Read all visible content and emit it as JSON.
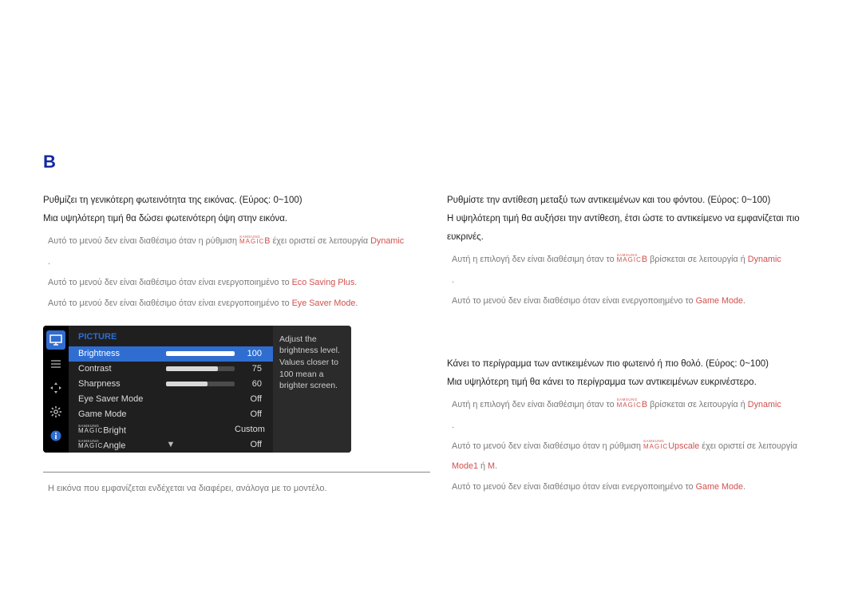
{
  "section_mark": "B",
  "left": {
    "p1": "Ρυθμίζει τη γενικότερη φωτεινότητα της εικόνας. (Εύρος: 0~100)",
    "p2": "Μια υψηλότερη τιμή θα δώσει φωτεινότερη όψη στην εικόνα.",
    "b1_pre": "Αυτό το μενού δεν είναι διαθέσιμο όταν η ρύθμιση ",
    "b1_mid": "B",
    "b1_after": " έχει οριστεί σε λειτουργία ",
    "b1_red": "Dynamic",
    "b1_end": ".",
    "b2_pre": "Αυτό το μενού δεν είναι διαθέσιμο όταν είναι ενεργοποιημένο το ",
    "b2_red": "Eco Saving Plus",
    "b2_end": ".",
    "b3_pre": "Αυτό το μενού δεν είναι διαθέσιμο όταν είναι ενεργοποιημένο το ",
    "b3_red": "Eye Saver Mode",
    "b3_end": ".",
    "footnote": "Η εικόνα που εμφανίζεται ενδέχεται να διαφέρει, ανάλογα με το μοντέλο.",
    "magic_top": "SAMSUNG",
    "magic_bot": "MAGIC"
  },
  "right1": {
    "p1": "Ρυθμίστε την αντίθεση μεταξύ των αντικειμένων και του φόντου. (Εύρος: 0~100)",
    "p2": "Η υψηλότερη τιμή θα αυξήσει την αντίθεση, έτσι ώστε το αντικείμενο να εμφανίζεται πιο ευκρινές.",
    "b1_pre": "Αυτή η επιλογή δεν είναι διαθέσιμη όταν το ",
    "b1_mid": "B",
    "b1_after": " βρίσκεται σε λειτουργία  ή ",
    "b1_red": "Dynamic",
    "b1_end": ".",
    "b2_pre": "Αυτό το μενού δεν είναι διαθέσιμο όταν είναι ενεργοποιημένο το ",
    "b2_red": "Game Mode",
    "b2_end": "."
  },
  "right2": {
    "p1": "Κάνει το περίγραμμα των αντικειμένων πιο φωτεινό ή πιο θολό. (Εύρος: 0~100)",
    "p2": "Μια υψηλότερη τιμή θα κάνει το περίγραμμα των αντικειμένων ευκρινέστερο.",
    "b1_pre": "Αυτή η επιλογή δεν είναι διαθέσιμη όταν το ",
    "b1_mid": "B",
    "b1_after": " βρίσκεται σε λειτουργία  ή ",
    "b1_red": "Dynamic",
    "b1_end": ".",
    "b2_pre": "Αυτό το μενού δεν είναι διαθέσιμο όταν η ρύθμιση ",
    "b2_magic_suffix": "Upscale",
    "b2_mid": " έχει οριστεί σε λειτουργία ",
    "b2_red1": "Mode1",
    "b2_or": " ή ",
    "b2_red2": "M",
    "b2_end": ".",
    "b3_pre": "Αυτό το μενού δεν είναι διαθέσιμο όταν είναι ενεργοποιημένο το ",
    "b3_red": "Game Mode",
    "b3_end": "."
  },
  "osd": {
    "title": "PICTURE",
    "rows": [
      {
        "label": "Brightness",
        "value": "100",
        "bar": 100,
        "selected": true
      },
      {
        "label": "Contrast",
        "value": "75",
        "bar": 75,
        "selected": false
      },
      {
        "label": "Sharpness",
        "value": "60",
        "bar": 60,
        "selected": false
      },
      {
        "label": "Eye Saver Mode",
        "value": "Off",
        "bar": null,
        "selected": false
      },
      {
        "label": "Game Mode",
        "value": "Off",
        "bar": null,
        "selected": false
      },
      {
        "label": "__MAGIC__Bright",
        "value": "Custom",
        "bar": null,
        "selected": false
      },
      {
        "label": "__MAGIC__Angle",
        "value": "Off",
        "bar": null,
        "selected": false
      }
    ],
    "desc": "Adjust the brightness level. Values closer to 100 mean a brighter screen.",
    "magic_top": "SAMSUNG",
    "magic_bot": "MAGIC"
  }
}
